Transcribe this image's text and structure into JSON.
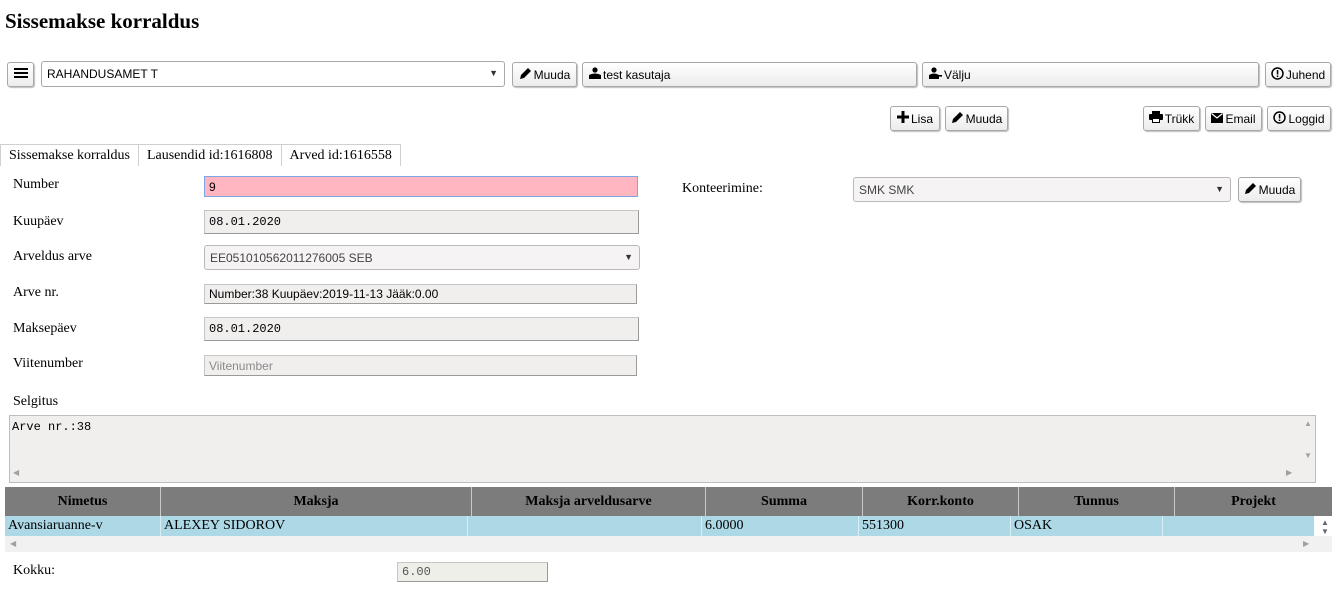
{
  "page": {
    "title": "Sissemakse korraldus"
  },
  "topbar": {
    "org_select": "RAHANDUSAMET T",
    "edit_label": "Muuda",
    "user_label": "test kasutaja",
    "exit_label": "Välju",
    "help_label": "Juhend"
  },
  "toolbar": {
    "add_label": "Lisa",
    "edit_label": "Muuda",
    "print_label": "Trükk",
    "email_label": "Email",
    "logs_label": "Loggid"
  },
  "tabs": [
    {
      "label": "Sissemakse korraldus"
    },
    {
      "label": "Lausendid id:1616808"
    },
    {
      "label": "Arved id:1616558"
    }
  ],
  "form": {
    "number_label": "Number",
    "number_value": "9",
    "kuupaev_label": "Kuupäev",
    "kuupaev_value": "08.01.2020",
    "arveldus_label": "Arveldus arve",
    "arveldus_value": "EE051010562011276005 SEB",
    "arve_label": "Arve nr.",
    "arve_value": "Number:38 Kuupäev:2019-11-13 Jääk:0.00",
    "maksepaev_label": "Maksepäev",
    "maksepaev_value": "08.01.2020",
    "viitenumber_label": "Viitenumber",
    "viitenumber_placeholder": "Viitenumber",
    "konteerimine_label": "Konteerimine:",
    "konteerimine_value": "SMK SMK",
    "konteerimine_edit": "Muuda",
    "selgitus_label": "Selgitus",
    "selgitus_value": "Arve nr.:38"
  },
  "grid": {
    "headers": [
      "Nimetus",
      "Maksja",
      "Maksja arveldusarve",
      "Summa",
      "Korr.konto",
      "Tunnus",
      "Projekt"
    ],
    "rows": [
      [
        "Avansiaruanne-v",
        "ALEXEY SIDOROV",
        "",
        "6.0000",
        "551300",
        "OSAK",
        ""
      ]
    ]
  },
  "total": {
    "label": "Kokku:",
    "value": "6.00"
  },
  "colors": {
    "header_bg": "#7c7c7c",
    "row_selected": "#add8e6",
    "invalid_field": "#ffb6c1"
  }
}
